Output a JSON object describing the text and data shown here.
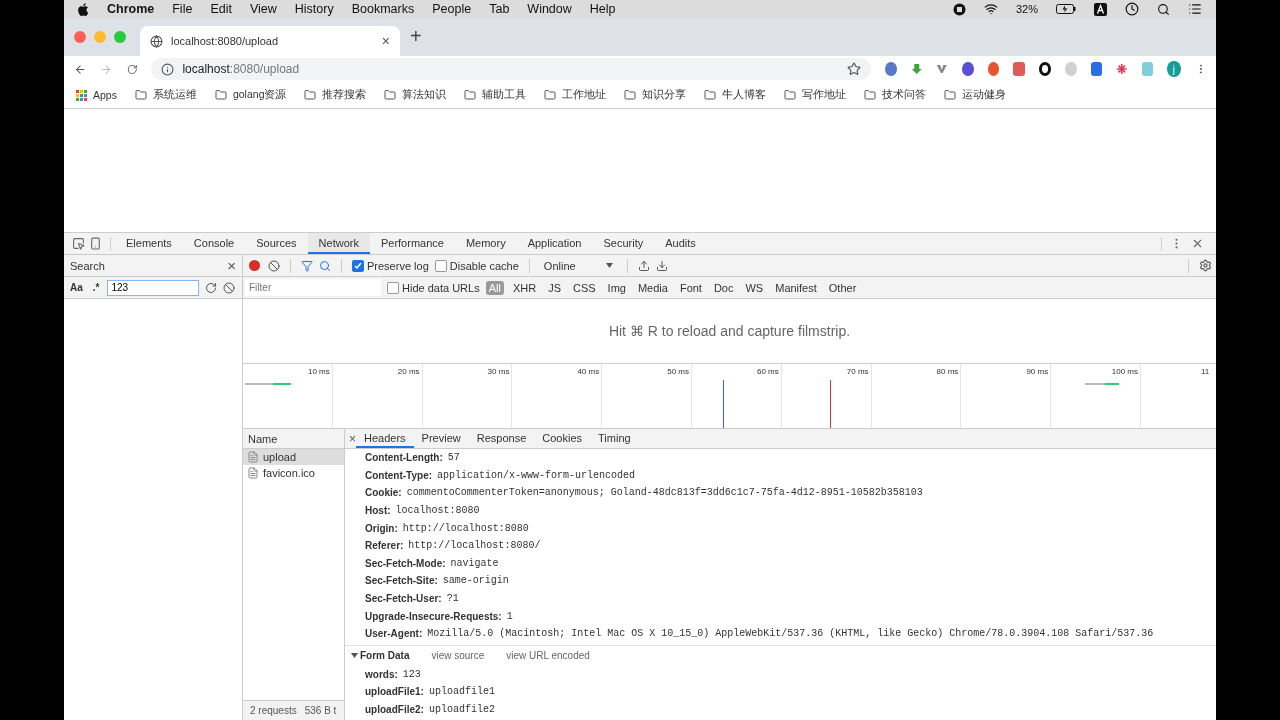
{
  "menubar": {
    "app": "Chrome",
    "items": [
      "File",
      "Edit",
      "View",
      "History",
      "Bookmarks",
      "People",
      "Tab",
      "Window",
      "Help"
    ],
    "battery": "32%"
  },
  "browser_tab": {
    "title": "localhost:8080/upload",
    "close": "×",
    "new_tab": "+"
  },
  "address_bar": {
    "url_host": "localhost",
    "url_rest": ":8080/upload"
  },
  "profile": {
    "initial": "j"
  },
  "bookmarks": [
    {
      "label": "Apps",
      "kind": "apps"
    },
    {
      "label": "系统运维",
      "kind": "folder"
    },
    {
      "label": "golang资源",
      "kind": "folder"
    },
    {
      "label": "推荐搜索",
      "kind": "folder"
    },
    {
      "label": "算法知识",
      "kind": "folder"
    },
    {
      "label": "辅助工具",
      "kind": "folder"
    },
    {
      "label": "工作地址",
      "kind": "folder"
    },
    {
      "label": "知识分享",
      "kind": "folder"
    },
    {
      "label": "牛人博客",
      "kind": "folder"
    },
    {
      "label": "写作地址",
      "kind": "folder"
    },
    {
      "label": "技术问答",
      "kind": "folder"
    },
    {
      "label": "运动健身",
      "kind": "folder"
    }
  ],
  "devtools": {
    "tabs": [
      {
        "label": "Elements",
        "selected": false
      },
      {
        "label": "Console",
        "selected": false
      },
      {
        "label": "Sources",
        "selected": false
      },
      {
        "label": "Network",
        "selected": true
      },
      {
        "label": "Performance",
        "selected": false
      },
      {
        "label": "Memory",
        "selected": false
      },
      {
        "label": "Application",
        "selected": false
      },
      {
        "label": "Security",
        "selected": false
      },
      {
        "label": "Audits",
        "selected": false
      }
    ],
    "search": {
      "title": "Search",
      "close": "×",
      "case_toggle": "Aa",
      "regex_toggle": ".*",
      "query": "123"
    },
    "network_toolbar": {
      "recording": true,
      "preserve_log": {
        "label": "Preserve log",
        "checked": true
      },
      "disable_cache": {
        "label": "Disable cache",
        "checked": false
      },
      "throttling": "Online"
    },
    "filter_bar": {
      "placeholder": "Filter",
      "hide_data_urls": {
        "label": "Hide data URLs",
        "checked": false
      },
      "types": [
        {
          "label": "All",
          "selected": true
        },
        {
          "label": "XHR",
          "selected": false
        },
        {
          "label": "JS",
          "selected": false
        },
        {
          "label": "CSS",
          "selected": false
        },
        {
          "label": "Img",
          "selected": false
        },
        {
          "label": "Media",
          "selected": false
        },
        {
          "label": "Font",
          "selected": false
        },
        {
          "label": "Doc",
          "selected": false
        },
        {
          "label": "WS",
          "selected": false
        },
        {
          "label": "Manifest",
          "selected": false
        },
        {
          "label": "Other",
          "selected": false
        }
      ]
    },
    "filmstrip_hint": "Hit ⌘ R to reload and capture filmstrip.",
    "timeline_ticks": [
      "10 ms",
      "20 ms",
      "30 ms",
      "40 ms",
      "50 ms",
      "60 ms",
      "70 ms",
      "80 ms",
      "90 ms",
      "100 ms",
      "11"
    ],
    "requests": {
      "header": "Name",
      "rows": [
        {
          "name": "upload",
          "selected": true
        },
        {
          "name": "favicon.ico",
          "selected": false
        }
      ]
    },
    "detail_tabs": {
      "close": "×",
      "tabs": [
        {
          "label": "Headers",
          "selected": true
        },
        {
          "label": "Preview",
          "selected": false
        },
        {
          "label": "Response",
          "selected": false
        },
        {
          "label": "Cookies",
          "selected": false
        },
        {
          "label": "Timing",
          "selected": false
        }
      ]
    },
    "request_headers": [
      {
        "name": "Content-Length:",
        "value": "57"
      },
      {
        "name": "Content-Type:",
        "value": "application/x-www-form-urlencoded"
      },
      {
        "name": "Cookie:",
        "value": "commentoCommenterToken=anonymous; Goland-48dc813f=3dd6c1c7-75fa-4d12-8951-10582b358103"
      },
      {
        "name": "Host:",
        "value": "localhost:8080"
      },
      {
        "name": "Origin:",
        "value": "http://localhost:8080"
      },
      {
        "name": "Referer:",
        "value": "http://localhost:8080/"
      },
      {
        "name": "Sec-Fetch-Mode:",
        "value": "navigate"
      },
      {
        "name": "Sec-Fetch-Site:",
        "value": "same-origin"
      },
      {
        "name": "Sec-Fetch-User:",
        "value": "?1"
      },
      {
        "name": "Upgrade-Insecure-Requests:",
        "value": "1"
      },
      {
        "name": "User-Agent:",
        "value": "Mozilla/5.0 (Macintosh; Intel Mac OS X 10_15_0) AppleWebKit/537.36 (KHTML, like Gecko) Chrome/78.0.3904.108 Safari/537.36"
      }
    ],
    "form_data": {
      "title": "Form Data",
      "expanded": true,
      "links": [
        "view source",
        "view URL encoded"
      ],
      "fields": [
        {
          "name": "words:",
          "value": "123"
        },
        {
          "name": "uploadFile1:",
          "value": "uploadfile1"
        },
        {
          "name": "uploadFile2:",
          "value": "uploadfile2"
        }
      ]
    },
    "status": [
      "2 requests",
      "536 B t"
    ]
  }
}
